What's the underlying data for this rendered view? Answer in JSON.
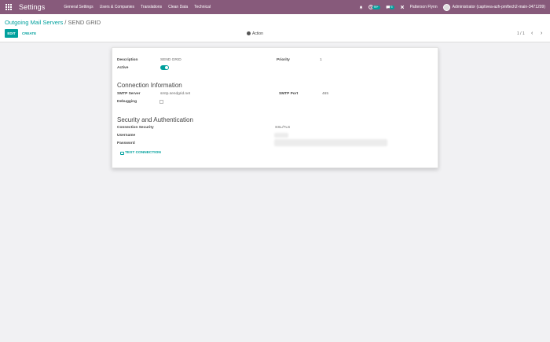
{
  "navbar": {
    "app_title": "Settings",
    "menu": [
      "General Settings",
      "Users & Companies",
      "Translations",
      "Clean Data",
      "Technical"
    ],
    "activity_badge": "99+",
    "message_badge": "5",
    "company": "Patterson Flynn",
    "user": "Administrator (captivea-azh-pmftech2-main-3471209)"
  },
  "control": {
    "breadcrumb_parent": "Outgoing Mail Servers",
    "breadcrumb_sep": "/",
    "breadcrumb_current": "SEND GRID",
    "edit_label": "EDIT",
    "create_label": "CREATE",
    "action_label": "Action",
    "pager": "1 / 1",
    "pager_prev": "‹",
    "pager_next": "›"
  },
  "form": {
    "description_label": "Description",
    "description_value": "SEND GRID",
    "priority_label": "Priority",
    "priority_value": "1",
    "active_label": "Active",
    "active_value": true,
    "connection_heading": "Connection Information",
    "smtp_server_label": "SMTP Server",
    "smtp_server_value": "smtp.sendgrid.net",
    "smtp_port_label": "SMTP Port",
    "smtp_port_value": "465",
    "debugging_label": "Debugging",
    "security_heading": "Security and Authentication",
    "connection_security_label": "Connection Security",
    "connection_security_value": "SSL/TLS",
    "username_label": "Username",
    "password_label": "Password",
    "test_connection_label": "TEST CONNECTION"
  },
  "colors": {
    "navbar": "#875a7b",
    "accent": "#00a09d",
    "background": "#f1f1f3"
  }
}
